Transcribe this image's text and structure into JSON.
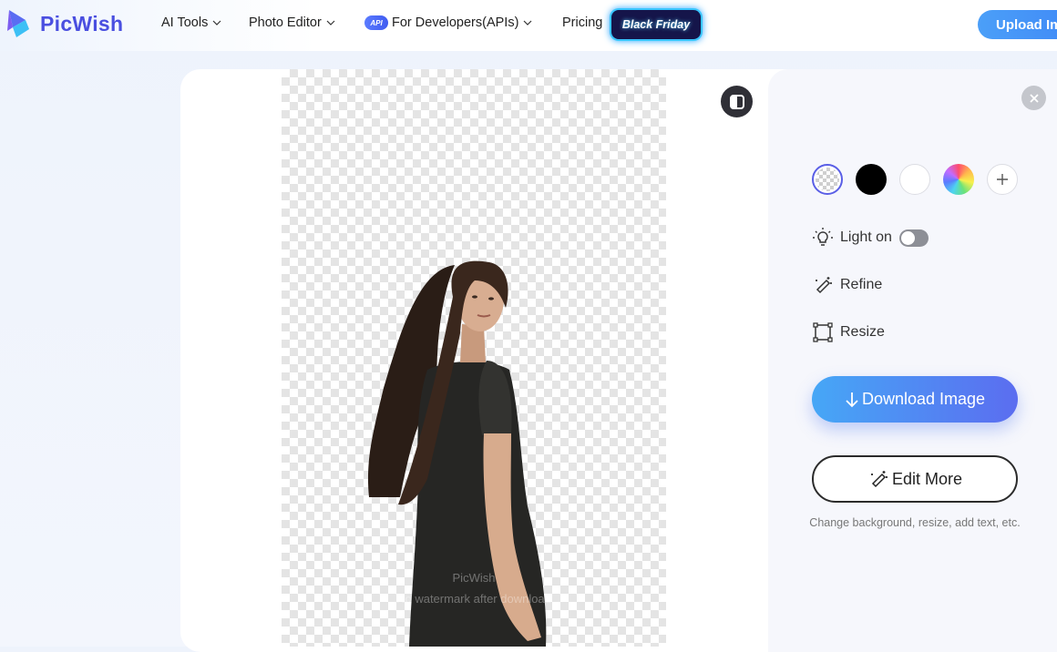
{
  "brand": {
    "name": "PicWish"
  },
  "nav": {
    "ai_tools": "AI Tools",
    "photo_editor": "Photo Editor",
    "api_badge": "API",
    "developers": "For Developers(APIs)",
    "pricing": "Pricing",
    "black_friday": "Black Friday",
    "upload": "Upload Im"
  },
  "canvas": {
    "watermark_brand": "PicWish",
    "watermark_note": "No watermark after download"
  },
  "panel": {
    "backgrounds": [
      "transparent",
      "black",
      "white",
      "color-picker",
      "add"
    ],
    "tools": {
      "light": "Light on",
      "light_enabled": false,
      "refine": "Refine",
      "resize": "Resize"
    },
    "download": "Download Image",
    "edit_more": "Edit More",
    "edit_note": "Change background, resize, add text, etc."
  },
  "colors": {
    "brand": "#4a4fe0",
    "accent_start": "#46a7f6",
    "accent_end": "#5b6df0",
    "selected_ring": "#5a5fe6"
  }
}
